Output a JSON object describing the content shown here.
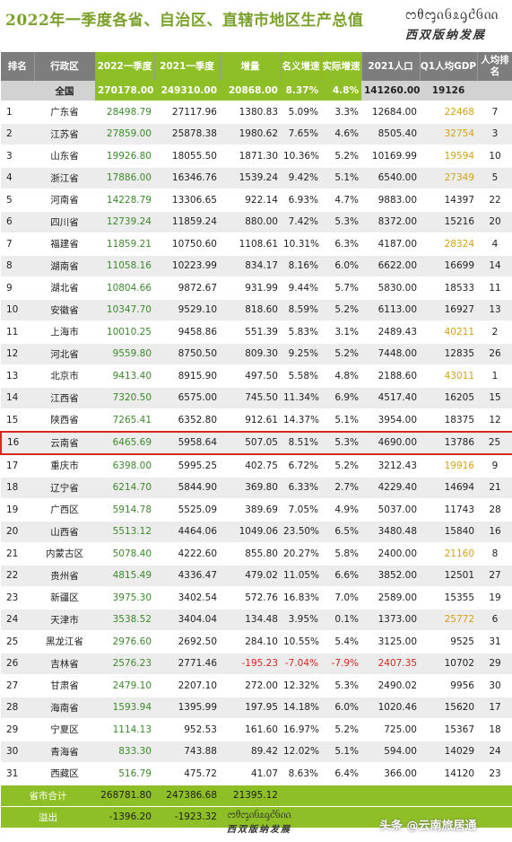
{
  "title": "2022年一季度各省、自治区、直辖市地区生产总值",
  "logo_script": "ᦂᦲᧅᦵᦑᦸᧂᦺᦑᦶ",
  "logo_cn": "西双版纳发展",
  "watermark": "头条 @云南旅居通",
  "colors": {
    "header_bg": "#7d7d7d",
    "accent_green": "#8fbf26",
    "title_green": "#7aa12a",
    "current_year_green": "#3b8a2a",
    "gold": "#d4a317",
    "negative_red": "#d8281e",
    "highlight_border": "#d8281e"
  },
  "columns": [
    "排名",
    "行政区",
    "2022一季度",
    "2021一季度",
    "增量",
    "名义增速",
    "实际增速",
    "2021人口",
    "Q1人均GDP",
    "人均排名"
  ],
  "total_row": {
    "rank": "",
    "name": "全国",
    "q2022": "270178.00",
    "q2021": "249310.00",
    "increase": "20868.00",
    "nominal": "8.37%",
    "real": "4.8%",
    "population": "141260.00",
    "per_capita": "19126",
    "per_rank": ""
  },
  "rows": [
    {
      "rank": "1",
      "name": "广东省",
      "q2022": "28498.79",
      "q2021": "27117.96",
      "increase": "1380.83",
      "nominal": "5.09%",
      "real": "3.3%",
      "population": "12684.00",
      "per_capita": "22468",
      "per_rank": "7",
      "gold": true
    },
    {
      "rank": "2",
      "name": "江苏省",
      "q2022": "27859.00",
      "q2021": "25878.38",
      "increase": "1980.62",
      "nominal": "7.65%",
      "real": "4.6%",
      "population": "8505.40",
      "per_capita": "32754",
      "per_rank": "3",
      "gold": true
    },
    {
      "rank": "3",
      "name": "山东省",
      "q2022": "19926.80",
      "q2021": "18055.50",
      "increase": "1871.30",
      "nominal": "10.36%",
      "real": "5.2%",
      "population": "10169.99",
      "per_capita": "19594",
      "per_rank": "10",
      "gold": true
    },
    {
      "rank": "4",
      "name": "浙江省",
      "q2022": "17886.00",
      "q2021": "16346.76",
      "increase": "1539.24",
      "nominal": "9.42%",
      "real": "5.1%",
      "population": "6540.00",
      "per_capita": "27349",
      "per_rank": "5",
      "gold": true
    },
    {
      "rank": "5",
      "name": "河南省",
      "q2022": "14228.79",
      "q2021": "13306.65",
      "increase": "922.14",
      "nominal": "6.93%",
      "real": "4.7%",
      "population": "9883.00",
      "per_capita": "14397",
      "per_rank": "22"
    },
    {
      "rank": "6",
      "name": "四川省",
      "q2022": "12739.24",
      "q2021": "11859.24",
      "increase": "880.00",
      "nominal": "7.42%",
      "real": "5.3%",
      "population": "8372.00",
      "per_capita": "15216",
      "per_rank": "20"
    },
    {
      "rank": "7",
      "name": "福建省",
      "q2022": "11859.21",
      "q2021": "10750.60",
      "increase": "1108.61",
      "nominal": "10.31%",
      "real": "6.3%",
      "population": "4187.00",
      "per_capita": "28324",
      "per_rank": "4",
      "gold": true
    },
    {
      "rank": "8",
      "name": "湖南省",
      "q2022": "11058.16",
      "q2021": "10223.99",
      "increase": "834.17",
      "nominal": "8.16%",
      "real": "6.0%",
      "population": "6622.00",
      "per_capita": "16699",
      "per_rank": "14"
    },
    {
      "rank": "9",
      "name": "湖北省",
      "q2022": "10804.66",
      "q2021": "9872.67",
      "increase": "931.99",
      "nominal": "9.44%",
      "real": "5.7%",
      "population": "5830.00",
      "per_capita": "18533",
      "per_rank": "11"
    },
    {
      "rank": "10",
      "name": "安徽省",
      "q2022": "10347.70",
      "q2021": "9529.10",
      "increase": "818.60",
      "nominal": "8.59%",
      "real": "5.2%",
      "population": "6113.00",
      "per_capita": "16927",
      "per_rank": "13"
    },
    {
      "rank": "11",
      "name": "上海市",
      "q2022": "10010.25",
      "q2021": "9458.86",
      "increase": "551.39",
      "nominal": "5.83%",
      "real": "3.1%",
      "population": "2489.43",
      "per_capita": "40211",
      "per_rank": "2",
      "gold": true
    },
    {
      "rank": "12",
      "name": "河北省",
      "q2022": "9559.80",
      "q2021": "8750.50",
      "increase": "809.30",
      "nominal": "9.25%",
      "real": "5.2%",
      "population": "7448.00",
      "per_capita": "12835",
      "per_rank": "26"
    },
    {
      "rank": "13",
      "name": "北京市",
      "q2022": "9413.40",
      "q2021": "8915.90",
      "increase": "497.50",
      "nominal": "5.58%",
      "real": "4.8%",
      "population": "2188.60",
      "per_capita": "43011",
      "per_rank": "1",
      "gold": true
    },
    {
      "rank": "14",
      "name": "江西省",
      "q2022": "7320.50",
      "q2021": "6575.00",
      "increase": "745.50",
      "nominal": "11.34%",
      "real": "6.9%",
      "population": "4517.40",
      "per_capita": "16205",
      "per_rank": "15"
    },
    {
      "rank": "15",
      "name": "陕西省",
      "q2022": "7265.41",
      "q2021": "6352.80",
      "increase": "912.61",
      "nominal": "14.37%",
      "real": "5.1%",
      "population": "3954.00",
      "per_capita": "18375",
      "per_rank": "12"
    },
    {
      "rank": "16",
      "name": "云南省",
      "q2022": "6465.69",
      "q2021": "5958.64",
      "increase": "507.05",
      "nominal": "8.51%",
      "real": "5.3%",
      "population": "4690.00",
      "per_capita": "13786",
      "per_rank": "25",
      "highlight": true
    },
    {
      "rank": "17",
      "name": "重庆市",
      "q2022": "6398.00",
      "q2021": "5995.25",
      "increase": "402.75",
      "nominal": "6.72%",
      "real": "5.2%",
      "population": "3212.43",
      "per_capita": "19916",
      "per_rank": "9",
      "gold": true
    },
    {
      "rank": "18",
      "name": "辽宁省",
      "q2022": "6214.70",
      "q2021": "5844.90",
      "increase": "369.80",
      "nominal": "6.33%",
      "real": "2.7%",
      "population": "4229.40",
      "per_capita": "14694",
      "per_rank": "21"
    },
    {
      "rank": "19",
      "name": "广西区",
      "q2022": "5914.78",
      "q2021": "5525.09",
      "increase": "389.69",
      "nominal": "7.05%",
      "real": "4.9%",
      "population": "5037.00",
      "per_capita": "11743",
      "per_rank": "28"
    },
    {
      "rank": "20",
      "name": "山西省",
      "q2022": "5513.12",
      "q2021": "4464.06",
      "increase": "1049.06",
      "nominal": "23.50%",
      "real": "6.5%",
      "population": "3480.48",
      "per_capita": "15840",
      "per_rank": "16"
    },
    {
      "rank": "21",
      "name": "内蒙古区",
      "q2022": "5078.40",
      "q2021": "4222.60",
      "increase": "855.80",
      "nominal": "20.27%",
      "real": "5.8%",
      "population": "2400.00",
      "per_capita": "21160",
      "per_rank": "8",
      "gold": true
    },
    {
      "rank": "22",
      "name": "贵州省",
      "q2022": "4815.49",
      "q2021": "4336.47",
      "increase": "479.02",
      "nominal": "11.05%",
      "real": "6.6%",
      "population": "3852.00",
      "per_capita": "12501",
      "per_rank": "27"
    },
    {
      "rank": "23",
      "name": "新疆区",
      "q2022": "3975.30",
      "q2021": "3402.54",
      "increase": "572.76",
      "nominal": "16.83%",
      "real": "7.0%",
      "population": "2589.00",
      "per_capita": "15355",
      "per_rank": "19"
    },
    {
      "rank": "24",
      "name": "天津市",
      "q2022": "3538.52",
      "q2021": "3404.04",
      "increase": "134.48",
      "nominal": "3.95%",
      "real": "0.1%",
      "population": "1373.00",
      "per_capita": "25772",
      "per_rank": "6",
      "gold": true
    },
    {
      "rank": "25",
      "name": "黑龙江省",
      "q2022": "2976.60",
      "q2021": "2692.50",
      "increase": "284.10",
      "nominal": "10.55%",
      "real": "5.4%",
      "population": "3125.00",
      "per_capita": "9525",
      "per_rank": "31"
    },
    {
      "rank": "26",
      "name": "吉林省",
      "q2022": "2576.23",
      "q2021": "2771.46",
      "increase": "-195.23",
      "nominal": "-7.04%",
      "real": "-7.9%",
      "population": "2407.35",
      "per_capita": "10702",
      "per_rank": "29",
      "negative": true
    },
    {
      "rank": "27",
      "name": "甘肃省",
      "q2022": "2479.10",
      "q2021": "2207.10",
      "increase": "272.00",
      "nominal": "12.32%",
      "real": "5.3%",
      "population": "2490.02",
      "per_capita": "9956",
      "per_rank": "30"
    },
    {
      "rank": "28",
      "name": "海南省",
      "q2022": "1593.94",
      "q2021": "1395.99",
      "increase": "197.95",
      "nominal": "14.18%",
      "real": "6.0%",
      "population": "1020.46",
      "per_capita": "15620",
      "per_rank": "17"
    },
    {
      "rank": "29",
      "name": "宁夏区",
      "q2022": "1114.13",
      "q2021": "952.53",
      "increase": "161.60",
      "nominal": "16.97%",
      "real": "5.2%",
      "population": "725.00",
      "per_capita": "15367",
      "per_rank": "18"
    },
    {
      "rank": "30",
      "name": "青海省",
      "q2022": "833.30",
      "q2021": "743.88",
      "increase": "89.42",
      "nominal": "12.02%",
      "real": "5.1%",
      "population": "594.00",
      "per_capita": "14029",
      "per_rank": "24"
    },
    {
      "rank": "31",
      "name": "西藏区",
      "q2022": "516.79",
      "q2021": "475.72",
      "increase": "41.07",
      "nominal": "8.63%",
      "real": "6.4%",
      "population": "366.00",
      "per_capita": "14120",
      "per_rank": "23"
    }
  ],
  "sum_row": {
    "label": "省市合计",
    "q2022": "268781.80",
    "q2021": "247386.68",
    "increase": "21395.12"
  },
  "overflow_row": {
    "label": "溢出",
    "q2022": "-1396.20",
    "q2021": "-1923.32"
  }
}
